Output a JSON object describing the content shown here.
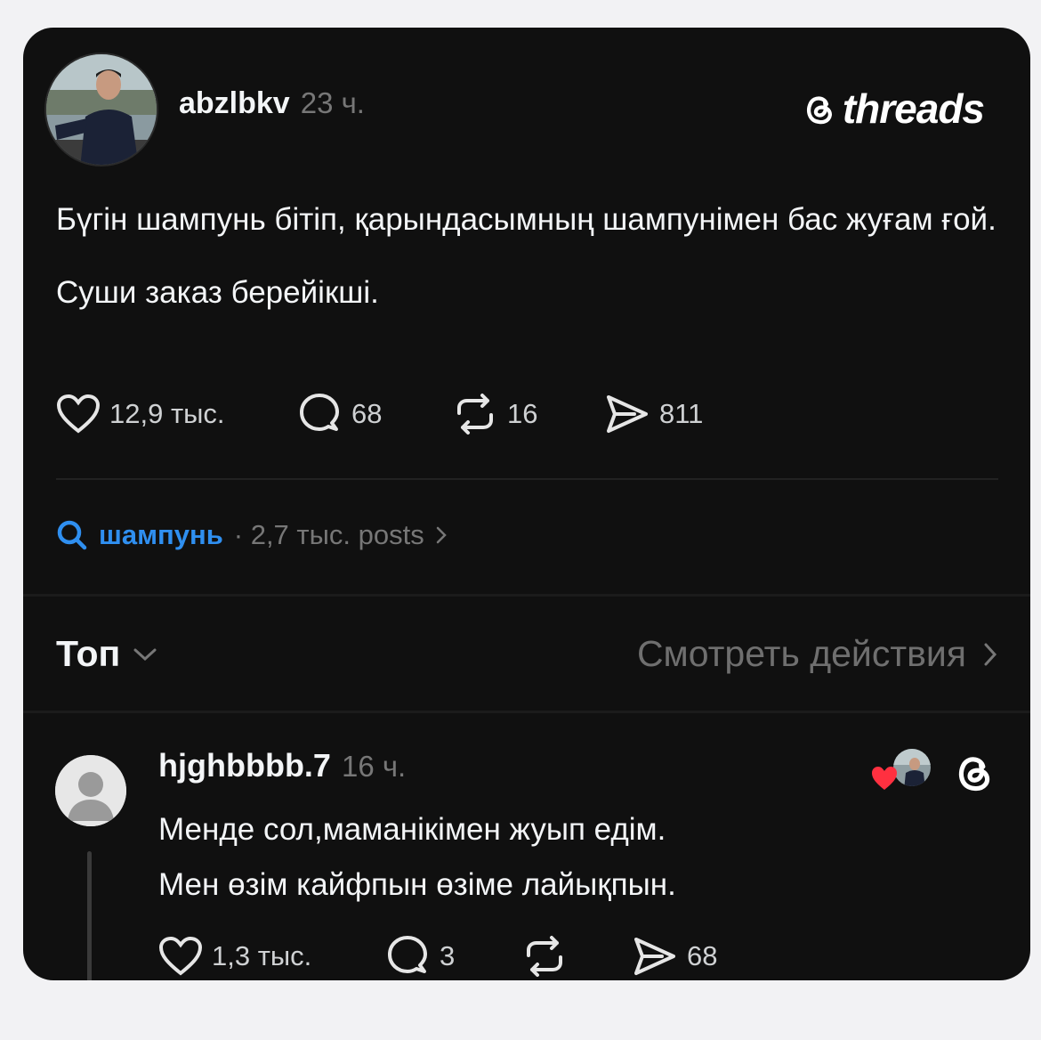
{
  "post": {
    "username": "abzlbkv",
    "time": "23 ч.",
    "brand": "threads",
    "paragraphs": [
      "Бүгін шампунь бітіп, қарындасымның шампунімен бас жуғам ғой.",
      "Суши заказ берейікші."
    ],
    "likes": "12,9 тыс.",
    "replies": "68",
    "reposts": "16",
    "shares": "811"
  },
  "topic": {
    "name": "шампунь",
    "meta": "· 2,7 тыс. posts"
  },
  "sort": {
    "label": "Топ",
    "activity": "Смотреть действия"
  },
  "reply": {
    "username": "hjghbbbb.7",
    "time": "16 ч.",
    "lines": [
      "Менде сол,маманікімен жуып едім.",
      "Мен өзім кайфпын өзіме лайықпын."
    ],
    "likes": "1,3 тыс.",
    "replies": "3",
    "reposts": "",
    "shares": "68"
  },
  "colors": {
    "accent": "#2f8ff0",
    "heart": "#ff3040",
    "background": "#101010"
  },
  "icons": [
    "heart-icon",
    "comment-icon",
    "repost-icon",
    "share-icon",
    "search-icon",
    "chevron-down-icon",
    "chevron-right-icon",
    "threads-logo-icon"
  ]
}
